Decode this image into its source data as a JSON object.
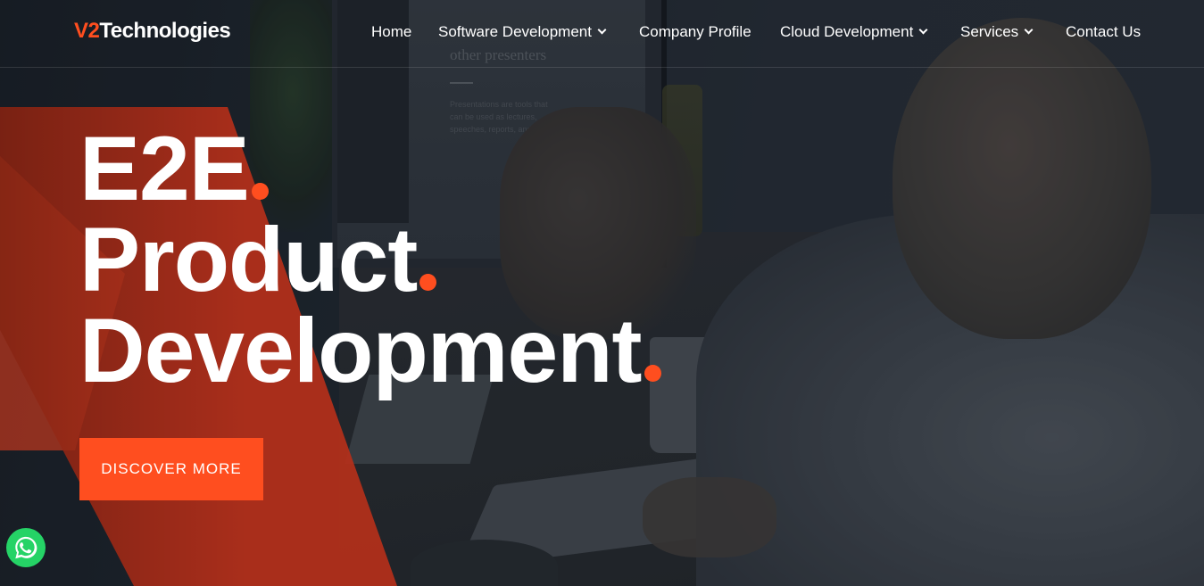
{
  "brand": {
    "logo_prefix": "V2",
    "logo_suffix": "Technologies",
    "accent_color": "#ff4e1f"
  },
  "nav": {
    "items": [
      {
        "label": "Home",
        "has_dropdown": false
      },
      {
        "label": "Software Development",
        "has_dropdown": true
      },
      {
        "label": "Company Profile",
        "has_dropdown": false
      },
      {
        "label": "Cloud Development",
        "has_dropdown": true
      },
      {
        "label": "Services",
        "has_dropdown": true
      },
      {
        "label": "Contact Us",
        "has_dropdown": false
      }
    ]
  },
  "hero": {
    "lines": [
      "E2E",
      "Product",
      "Development"
    ],
    "cta_label": "DISCOVER MORE",
    "background_screen_title": "other presenters",
    "background_screen_text": "Presentations are tools that can be used as lectures, speeches, reports, and more."
  },
  "widgets": {
    "whatsapp_icon": "whatsapp-icon"
  }
}
